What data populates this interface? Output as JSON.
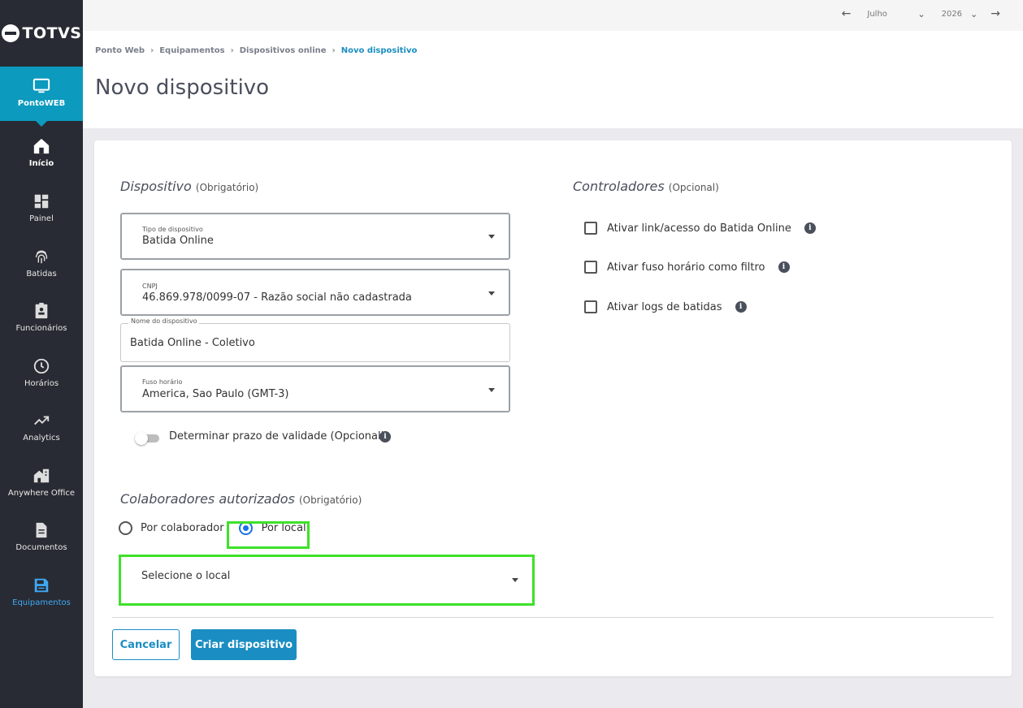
{
  "brand": {
    "logo_text": "TOTVS"
  },
  "sidebar": {
    "active_module": "PontoWEB",
    "items": [
      {
        "label": "Início",
        "icon": "home-icon"
      },
      {
        "label": "Painel",
        "icon": "dashboard-icon"
      },
      {
        "label": "Batidas",
        "icon": "fingerprint-icon"
      },
      {
        "label": "Funcionários",
        "icon": "badge-icon"
      },
      {
        "label": "Horários",
        "icon": "clock-icon"
      },
      {
        "label": "Analytics",
        "icon": "trending-up-icon"
      },
      {
        "label": "Anywhere Office",
        "icon": "home-work-icon"
      },
      {
        "label": "Documentos",
        "icon": "document-icon"
      },
      {
        "label": "Equipamentos",
        "icon": "save-device-icon"
      }
    ]
  },
  "topbar": {
    "month": "Julho",
    "year": "2026"
  },
  "breadcrumb": [
    "Ponto Web",
    "Equipamentos",
    "Dispositivos online",
    "Novo dispositivo"
  ],
  "page_title": "Novo dispositivo",
  "dispositivo": {
    "title": "Dispositivo",
    "tag": "(Obrigatório)",
    "tipo": {
      "label": "Tipo de dispositivo",
      "value": "Batida Online"
    },
    "cnpj": {
      "label": "CNPJ",
      "value": "46.869.978/0099-07 - Razão social não cadastrada"
    },
    "nome": {
      "label": "Nome do dispositivo",
      "value": "Batida Online - Coletivo"
    },
    "fuso": {
      "label": "Fuso horário",
      "value": "America, Sao Paulo (GMT-3)"
    },
    "validade_label": "Determinar prazo de validade (Opcional)"
  },
  "colaboradores": {
    "title": "Colaboradores autorizados",
    "tag": "(Obrigatório)",
    "option_colaborador": "Por colaborador",
    "option_local": "Por local",
    "selected": "Por local",
    "local_placeholder": "Selecione o local"
  },
  "controladores": {
    "title": "Controladores",
    "tag": "(Opcional)",
    "options": [
      {
        "label": "Ativar link/acesso do Batida Online",
        "checked": false
      },
      {
        "label": "Ativar fuso horário como filtro",
        "checked": false
      },
      {
        "label": "Ativar logs de batidas",
        "checked": false
      }
    ]
  },
  "actions": {
    "cancel": "Cancelar",
    "create": "Criar dispositivo"
  },
  "colors": {
    "accent": "#1a8ec2",
    "sidebar": "#282b33",
    "active": "#0c9abe",
    "highlight": "#3ee12a"
  }
}
